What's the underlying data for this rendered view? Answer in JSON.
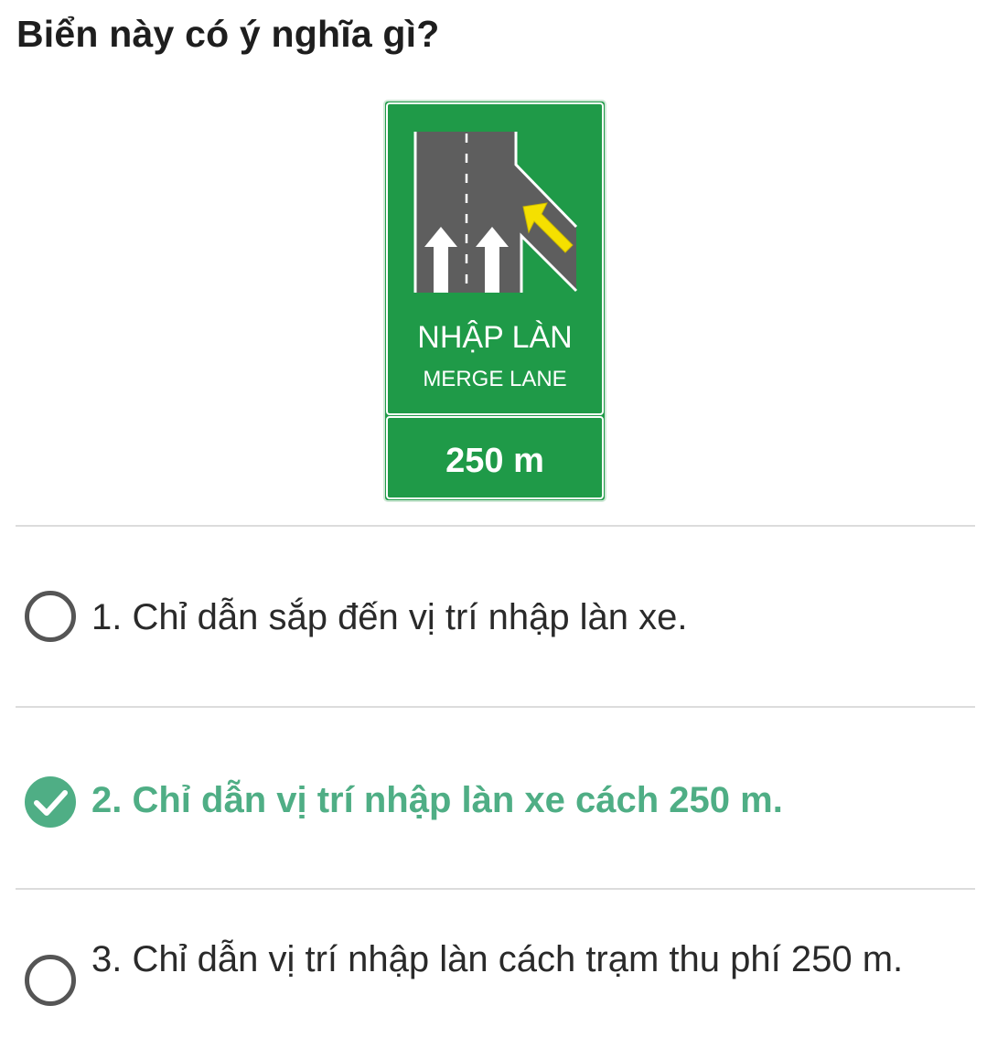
{
  "question": {
    "text": "Biển này có ý nghĩa gì?"
  },
  "sign": {
    "title_vi": "NHẬP LÀN",
    "title_en": "MERGE LANE",
    "distance": "250 m",
    "background_color": "#1f9a48",
    "road_color": "#5e5e5e",
    "arrow_color": "#ffffff",
    "merge_arrow_color": "#f5e000"
  },
  "answers": [
    {
      "label": "1. Chỉ dẫn sắp đến vị trí nhập làn xe.",
      "selected": false,
      "correct": false
    },
    {
      "label": "2. Chỉ dẫn vị trí nhập làn xe cách 250 m.",
      "selected": true,
      "correct": true
    },
    {
      "label": "3. Chỉ dẫn vị trí nhập làn cách trạm thu phí 250 m.",
      "selected": false,
      "correct": false
    }
  ],
  "colors": {
    "correct_accent": "#4fae85",
    "radio_border": "#555555",
    "divider": "#dcdcdc"
  },
  "icons": {
    "radio_unchecked": "radio-empty-circle",
    "radio_checked": "check-circle"
  }
}
